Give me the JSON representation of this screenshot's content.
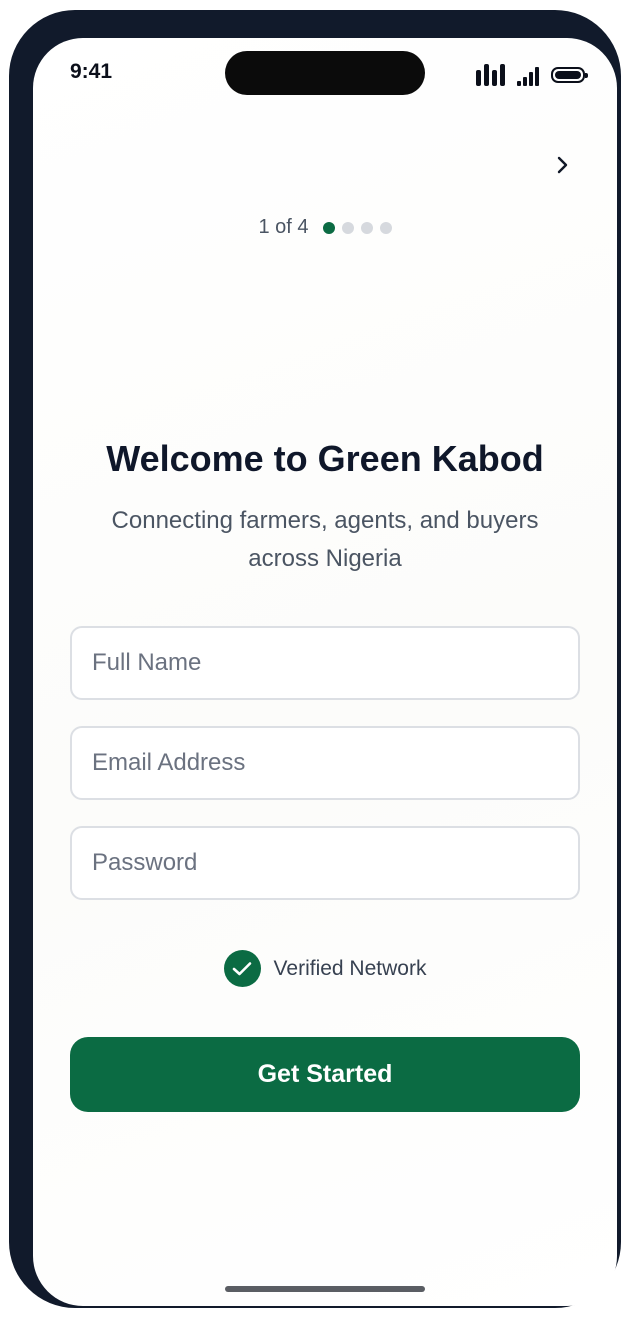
{
  "status_bar": {
    "time": "9:41"
  },
  "nav": {
    "next_icon": "chevron-right-icon"
  },
  "progress": {
    "step_text": "1 of 4",
    "current_step": 1,
    "total_steps": 4
  },
  "welcome": {
    "title": "Welcome to Green Kabod",
    "subtitle": "Connecting farmers, agents, and buyers across Nigeria"
  },
  "form": {
    "full_name": {
      "placeholder": "Full Name",
      "value": ""
    },
    "email": {
      "placeholder": "Email Address",
      "value": ""
    },
    "password": {
      "placeholder": "Password",
      "value": ""
    }
  },
  "badge": {
    "label": "Verified Network",
    "icon": "check-circle-icon"
  },
  "cta": {
    "label": "Get Started"
  },
  "colors": {
    "brand_green": "#0b6b43",
    "frame": "#111a2b",
    "inactive_dot": "#d6d9de",
    "title_text": "#0f172a"
  }
}
